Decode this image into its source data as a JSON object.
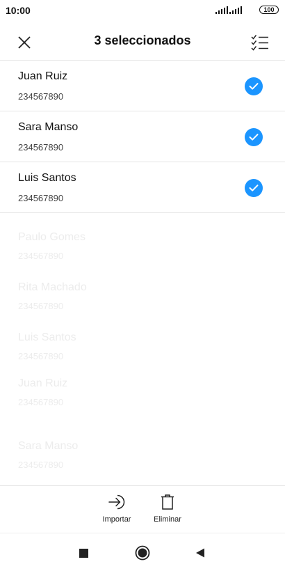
{
  "status_bar": {
    "time": "10:00",
    "battery": "100"
  },
  "header": {
    "title": "3 seleccionados",
    "close_icon": "close-icon",
    "select_all_icon": "checklist-icon"
  },
  "selected_contacts": [
    {
      "name": "Juan Ruiz",
      "phone": "234567890",
      "checked": true
    },
    {
      "name": "Sara Manso",
      "phone": "234567890",
      "checked": true
    },
    {
      "name": "Luis Santos",
      "phone": "234567890",
      "checked": true
    }
  ],
  "background_contacts": [
    {
      "name": "Paulo Gomes",
      "phone": "234567890"
    },
    {
      "name": "Rita Machado",
      "phone": "234567890"
    },
    {
      "name": "Luis Santos",
      "phone": "234567890"
    },
    {
      "name": "Juan Ruiz",
      "phone": "234567890"
    },
    {
      "name": "Sara Manso",
      "phone": "234567890"
    }
  ],
  "actions": {
    "import_label": "Importar",
    "delete_label": "Eliminar"
  },
  "colors": {
    "accent": "#1b95ff",
    "divider": "#e6e6e6"
  }
}
